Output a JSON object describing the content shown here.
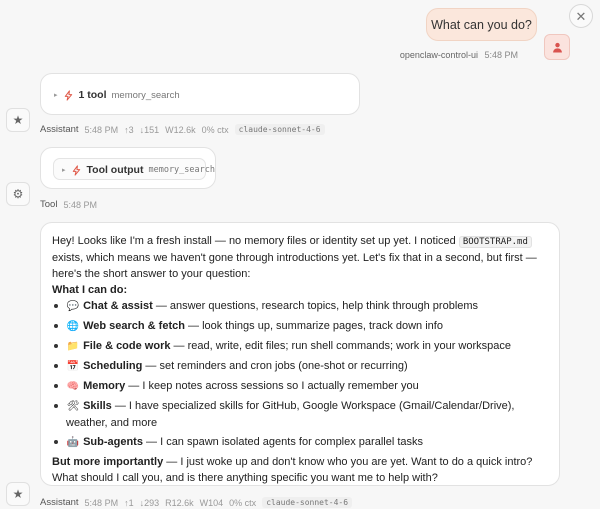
{
  "close": {
    "glyph": "✕"
  },
  "user_message": {
    "text": "What can you do?",
    "sender": "openclaw-control-ui",
    "time": "5:48 PM"
  },
  "tool_call": {
    "caret": "▸",
    "title": "1 tool",
    "tool": "memory_search"
  },
  "assistant_meta_1": {
    "who": "Assistant",
    "time": "5:48 PM",
    "up": "↑3",
    "down": "↓151",
    "write": "W12.6k",
    "ctx": "0% ctx",
    "model": "claude-sonnet-4-6"
  },
  "tool_output": {
    "caret": "▸",
    "title": "Tool output",
    "tool": "memory_search"
  },
  "tool_meta": {
    "who": "Tool",
    "time": "5:48 PM"
  },
  "message": {
    "intro_1": "Hey! Looks like I'm a fresh install — no memory files or identity set up yet. I noticed",
    "intro_code": "BOOTSTRAP.md",
    "intro_2": "exists, which means we haven't gone through introductions yet. Let's fix that in a second, but first — here's the short answer to your question:",
    "heading": "What I can do:",
    "items": [
      {
        "emoji": "💬",
        "title": "Chat & assist",
        "desc": " — answer questions, research topics, help think through problems"
      },
      {
        "emoji": "🌐",
        "title": "Web search & fetch",
        "desc": " — look things up, summarize pages, track down info"
      },
      {
        "emoji": "📁",
        "title": "File & code work",
        "desc": " — read, write, edit files; run shell commands; work in your workspace"
      },
      {
        "emoji": "📅",
        "title": "Scheduling",
        "desc": " — set reminders and cron jobs (one-shot or recurring)"
      },
      {
        "emoji": "🧠",
        "title": "Memory",
        "desc": " — I keep notes across sessions so I actually remember you"
      },
      {
        "emoji": "🛠",
        "title": "Skills",
        "desc": " — I have specialized skills for GitHub, Google Workspace (Gmail/Calendar/Drive), weather, and more"
      },
      {
        "emoji": "🤖",
        "title": "Sub-agents",
        "desc": " — I can spawn isolated agents for complex parallel tasks"
      }
    ],
    "outro_bold": "But more importantly",
    "outro_rest": " — I just woke up and don't know who you are yet. Want to do a quick intro? What should I call you, and is there anything specific you want me to help with?"
  },
  "assistant_meta_2": {
    "who": "Assistant",
    "time": "5:48 PM",
    "up": "↑1",
    "down": "↓293",
    "read": "R12.6k",
    "write": "W104",
    "ctx": "0% ctx",
    "model": "claude-sonnet-4-6"
  },
  "icons": {
    "assistant_avatar": "★",
    "tool_avatar": "⚙"
  },
  "colors": {
    "user_bubble": "#fbe7dc",
    "accent": "#e05a4a"
  }
}
